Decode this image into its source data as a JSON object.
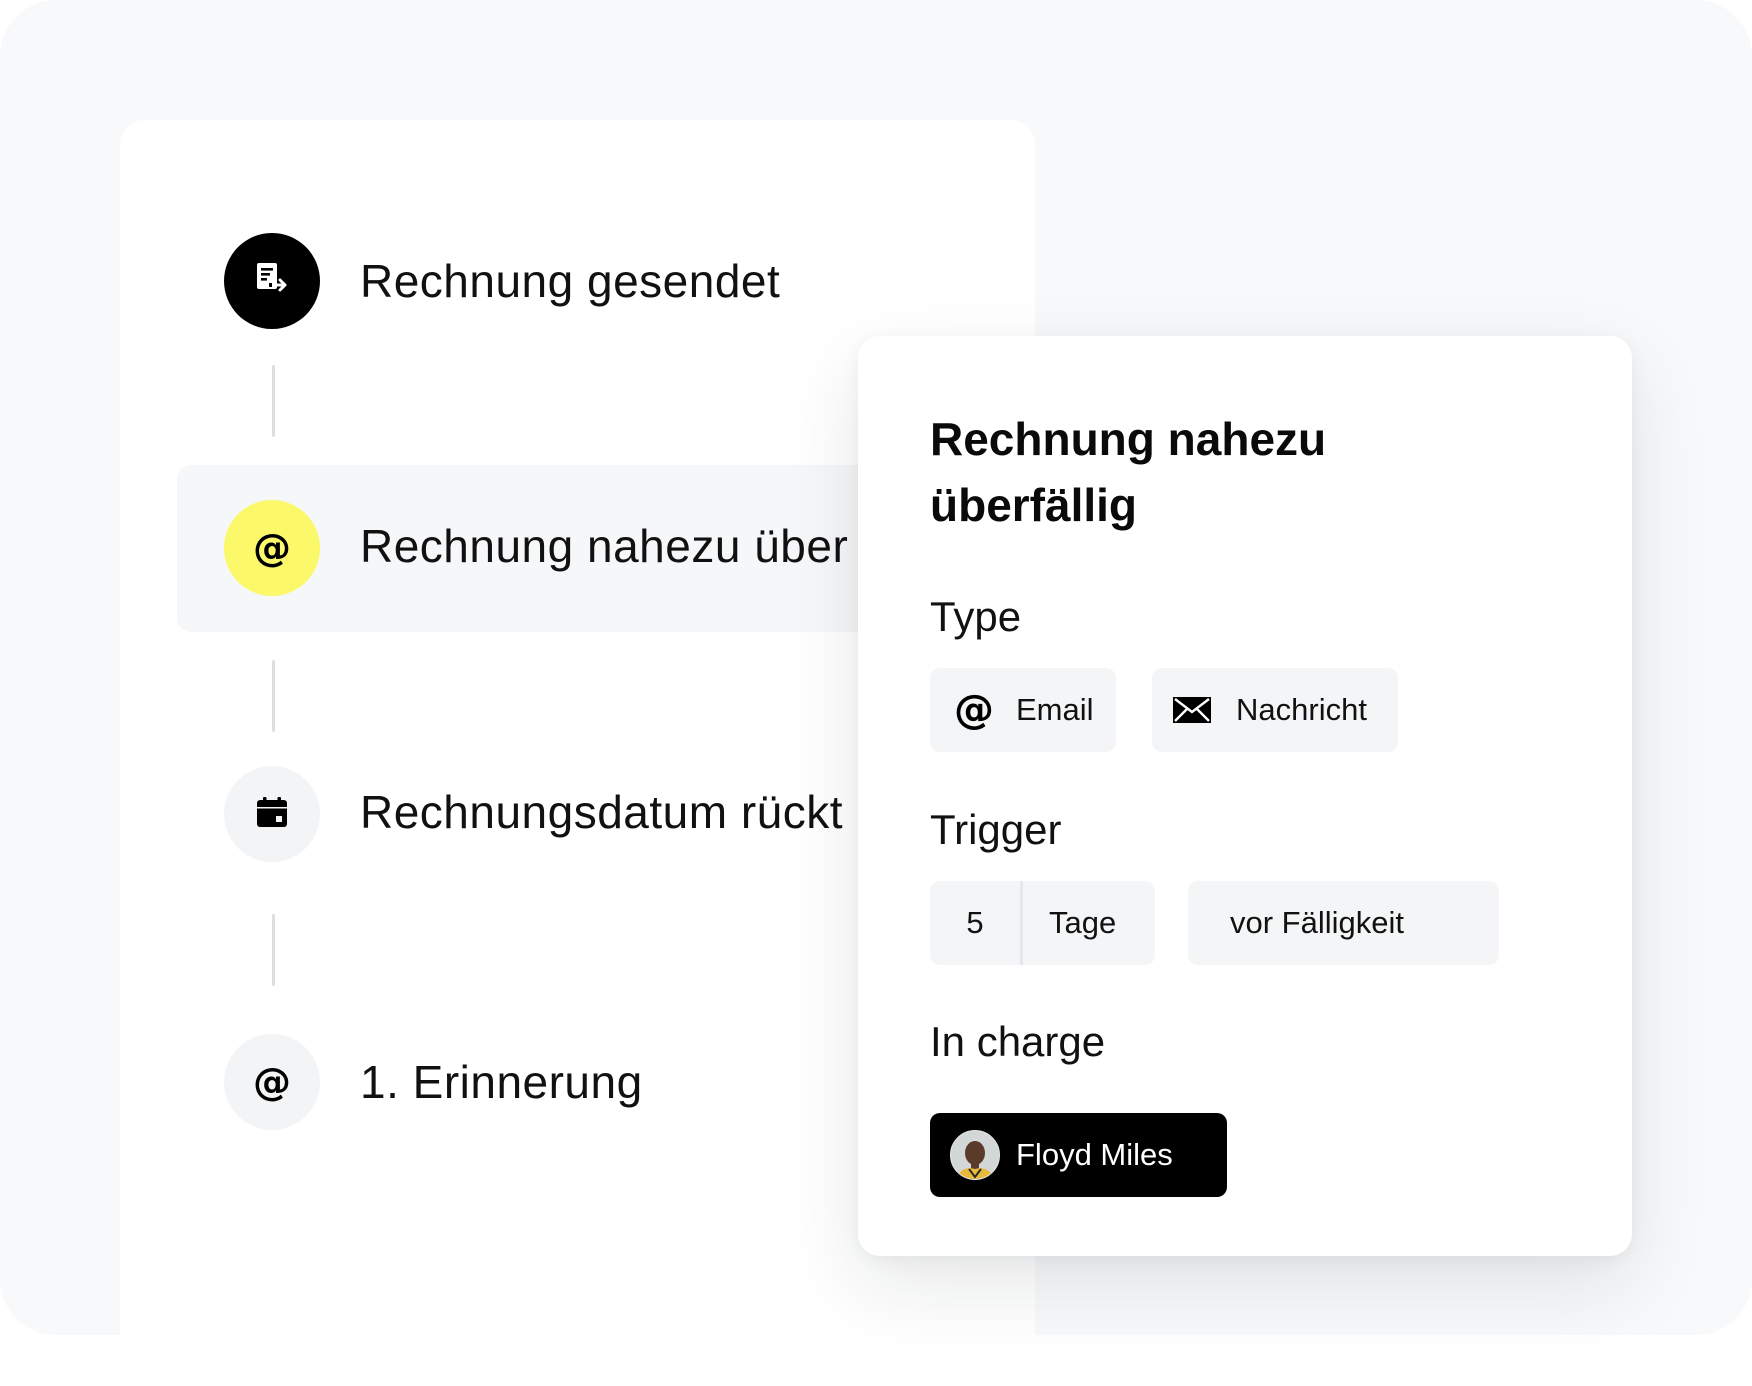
{
  "timeline": {
    "steps": [
      {
        "label": "Rechnung gesendet",
        "icon": "invoice-send-icon"
      },
      {
        "label": "Rechnung nahezu über",
        "icon": "at-sign-icon"
      },
      {
        "label": "Rechnungsdatum rückt",
        "icon": "calendar-icon"
      },
      {
        "label": "1. Erinnerung",
        "icon": "at-sign-icon"
      }
    ],
    "active_index": 1
  },
  "detail_panel": {
    "title": "Rechnung nahezu überfällig",
    "type_label": "Type",
    "type_options": [
      {
        "label": "Email",
        "icon": "at-sign-icon"
      },
      {
        "label": "Nachricht",
        "icon": "envelope-icon"
      }
    ],
    "trigger_label": "Trigger",
    "trigger": {
      "amount": "5",
      "unit": "Tage",
      "relation": "vor Fälligkeit"
    },
    "in_charge_label": "In charge",
    "assignee": {
      "name": "Floyd Miles"
    }
  },
  "colors": {
    "background": "#f8f9fa",
    "active_step": "#fbf86a",
    "done_step": "#000000",
    "pending_step": "#f3f4f6",
    "assignee_chip": "#000000"
  }
}
